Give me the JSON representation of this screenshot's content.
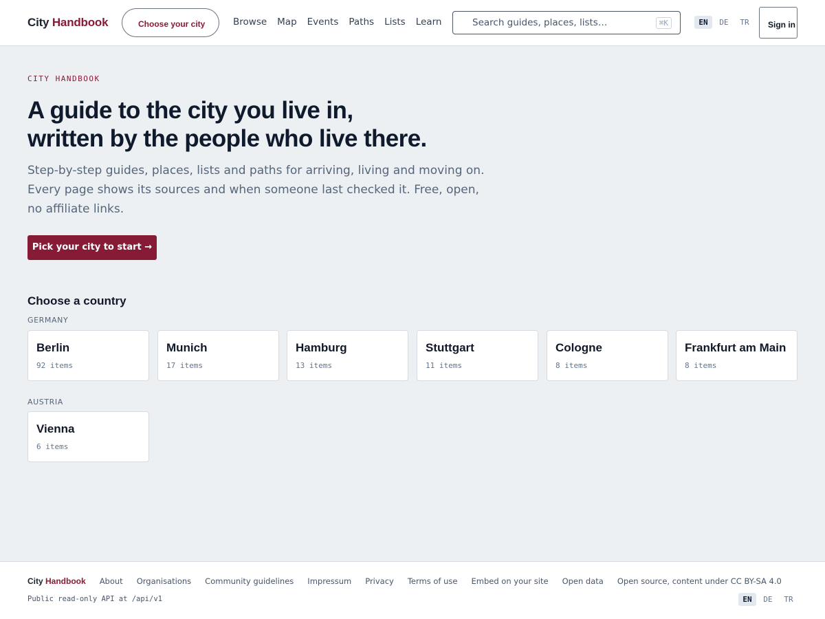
{
  "header": {
    "brand_first": "City",
    "brand_second": "Handbook",
    "choose_city": "Choose your city",
    "nav": [
      "Browse",
      "Map",
      "Events",
      "Paths",
      "Lists",
      "Learn"
    ],
    "search_placeholder": "Search guides, places, lists…",
    "search_shortcut": "⌘K",
    "languages": [
      "EN",
      "DE",
      "TR"
    ],
    "active_language": "EN",
    "sign_in": "Sign in"
  },
  "hero": {
    "eyebrow": "CITY HANDBOOK",
    "headline_line1": "A guide to the city you live in,",
    "headline_line2": "written by the people who live there.",
    "subtitle": "Step-by-step guides, places, lists and paths for arriving, living and moving on. Every page shows its sources and when someone last checked it. Free, open, no affiliate links.",
    "cta": "Pick your city to start →"
  },
  "countries_section": {
    "title": "Choose a country",
    "countries": [
      {
        "label": "GERMANY",
        "cities": [
          {
            "name": "Berlin",
            "count": "92 items"
          },
          {
            "name": "Munich",
            "count": "17 items"
          },
          {
            "name": "Hamburg",
            "count": "13 items"
          },
          {
            "name": "Stuttgart",
            "count": "11 items"
          },
          {
            "name": "Cologne",
            "count": "8 items"
          },
          {
            "name": "Frankfurt am Main",
            "count": "8 items"
          }
        ]
      },
      {
        "label": "AUSTRIA",
        "cities": [
          {
            "name": "Vienna",
            "count": "6 items"
          }
        ]
      }
    ]
  },
  "footer": {
    "brand_first": "City",
    "brand_second": "Handbook",
    "links": [
      "About",
      "Organisations",
      "Community guidelines",
      "Impressum",
      "Privacy",
      "Terms of use",
      "Embed on your site",
      "Open data"
    ],
    "license": "Open source, content under CC BY-SA 4.0",
    "api_note": "Public read-only API at /api/v1",
    "languages": [
      "EN",
      "DE",
      "TR"
    ]
  },
  "colors": {
    "accent": "#861b36",
    "background": "#edf0f3"
  }
}
